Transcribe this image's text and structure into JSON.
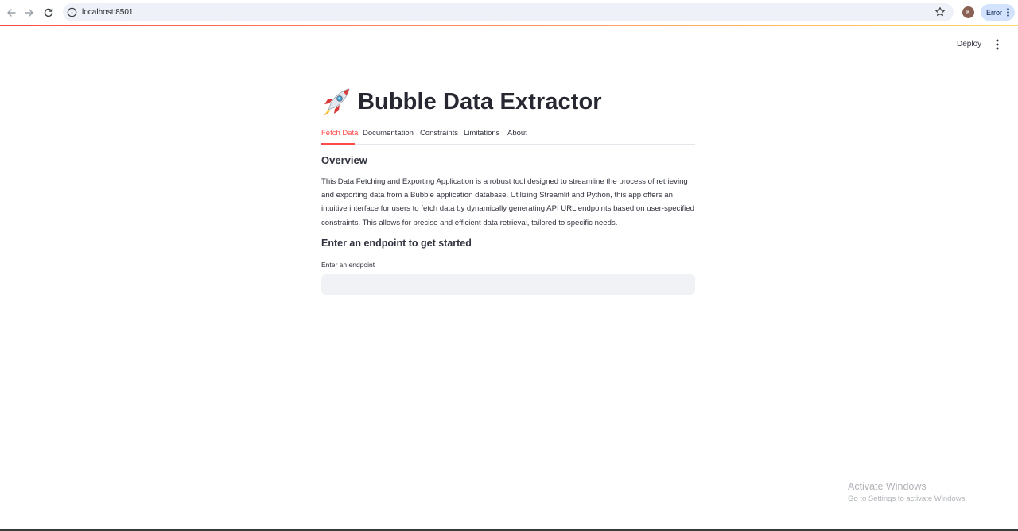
{
  "browser": {
    "url": "localhost:8501",
    "profile_initial": "K",
    "error_label": "Error"
  },
  "header": {
    "deploy_label": "Deploy"
  },
  "page": {
    "title": "Bubble Data Extractor",
    "title_icon": "rocket-icon",
    "tabs": [
      {
        "label": "Fetch Data",
        "active": true
      },
      {
        "label": "Documentation",
        "active": false
      },
      {
        "label": "Constraints",
        "active": false
      },
      {
        "label": "Limitations",
        "active": false
      },
      {
        "label": "About",
        "active": false
      }
    ],
    "overview_heading": "Overview",
    "overview_text": "This Data Fetching and Exporting Application is a robust tool designed to streamline the process of retrieving and exporting data from a Bubble application database. Utilizing Streamlit and Python, this app offers an intuitive interface for users to fetch data by dynamically generating API URL endpoints based on user-specified constraints. This allows for precise and efficient data retrieval, tailored to specific needs.",
    "endpoint_heading": "Enter an endpoint to get started",
    "endpoint_label": "Enter an endpoint",
    "endpoint_value": ""
  },
  "watermark": {
    "title": "Activate Windows",
    "subtitle": "Go to Settings to activate Windows."
  },
  "colors": {
    "accent": "#ff4b4b",
    "text": "#31333f",
    "input_bg": "#f0f2f6"
  }
}
